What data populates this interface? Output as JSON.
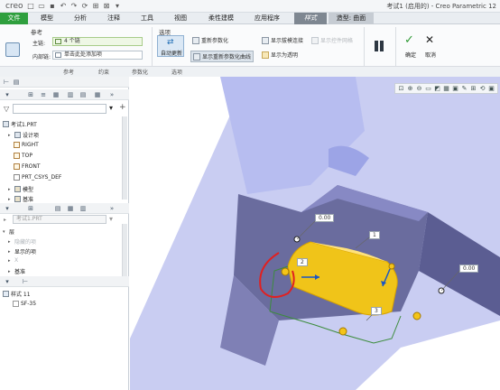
{
  "titlebar": {
    "logo": "creo",
    "title": "考试1 (启用的) - Creo Parametric 12"
  },
  "menubar": {
    "tabs": [
      "文件",
      "模型",
      "分析",
      "注释",
      "工具",
      "视图",
      "柔性建模",
      "应用程序",
      "样式",
      "造型: 曲面"
    ]
  },
  "ribbon": {
    "ref_group_label": "参考",
    "main_chain_label": "主链:",
    "main_chain_value": "4 个链",
    "inner_chain_label": "内部链:",
    "inner_chain_value": "单击此处添加项",
    "options_label": "选项",
    "auto_update": "自动更新",
    "reparam": "重新参数化",
    "show_reparam_curves": "显示重新参数化曲线",
    "show_isoline": "显示拔模连接",
    "show_control_net": "显示控件网格",
    "show_transparent": "显示为透明",
    "confirm": "确定",
    "cancel": "取消",
    "group_labels": [
      "参考",
      "约束",
      "参数化",
      "选项"
    ]
  },
  "model_tree": {
    "filename": "考试1.PRT",
    "items": [
      "设计项",
      "RIGHT",
      "TOP",
      "FRONT",
      "PRT_CSYS_DEF",
      "模型",
      "基准"
    ]
  },
  "layer_tree": {
    "model_select": "考试1.PRT",
    "items": [
      "层",
      "隐藏的项",
      "显示的项",
      "X",
      "基准"
    ]
  },
  "style_tree": {
    "root": "样式 11",
    "child": "SF-35"
  },
  "viewport": {
    "dims": [
      "0.00",
      "0.00",
      "1",
      "2",
      "3"
    ]
  }
}
